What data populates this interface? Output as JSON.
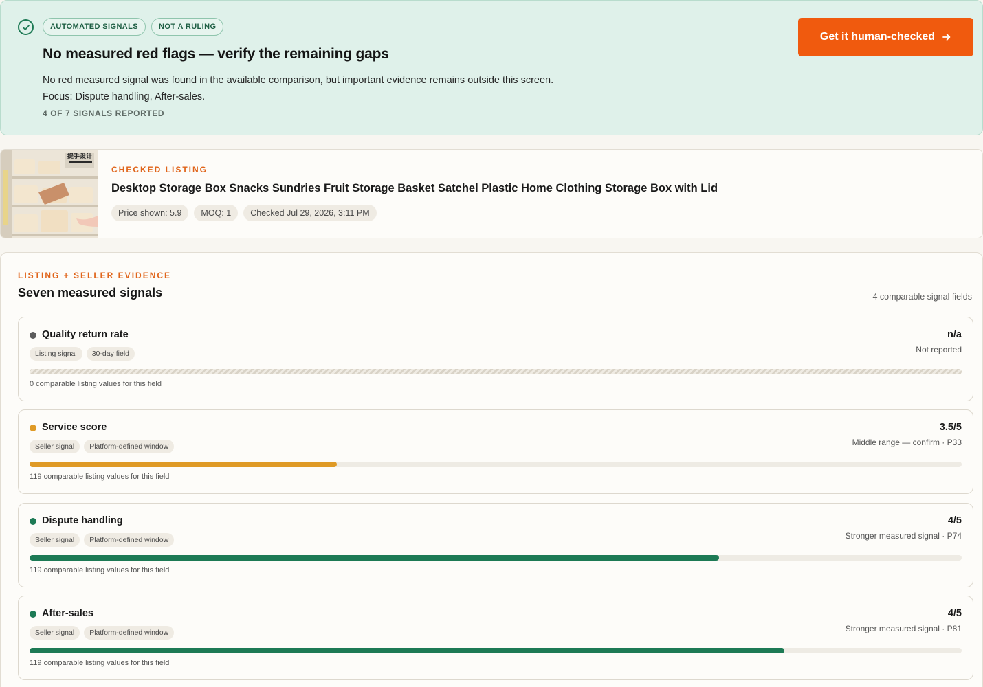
{
  "verdict": {
    "badges": [
      "AUTOMATED SIGNALS",
      "NOT A RULING"
    ],
    "title": "No measured red flags — verify the remaining gaps",
    "body_line1": "No red measured signal was found in the available comparison, but important evidence remains outside this screen.",
    "body_line2": "Focus: Dispute handling, After-sales.",
    "signals_reported": "4 OF 7 SIGNALS REPORTED",
    "cta_label": "Get it human-checked",
    "icons": {
      "status": "check-circle-icon",
      "cta": "arrow-right-icon"
    }
  },
  "listing": {
    "eyebrow": "CHECKED LISTING",
    "title": "Desktop Storage Box Snacks Sundries Fruit Storage Basket Satchel Plastic Home Clothing Storage Box with Lid",
    "thumb_brand_text": "提手设计",
    "chips": [
      "Price shown: 5.9",
      "MOQ: 1",
      "Checked Jul 29, 2026, 3:11 PM"
    ]
  },
  "evidence": {
    "eyebrow": "LISTING + SELLER EVIDENCE",
    "title": "Seven measured signals",
    "field_count": "4 comparable signal fields",
    "signals": [
      {
        "name": "Quality return rate",
        "tags": [
          "Listing signal",
          "30-day field"
        ],
        "value": "n/a",
        "note": "Not reported",
        "footer": "0 comparable listing values for this field",
        "fill": 0,
        "reported": false,
        "color": "#5c5c5c"
      },
      {
        "name": "Service score",
        "tags": [
          "Seller signal",
          "Platform-defined window"
        ],
        "value": "3.5/5",
        "note": "Middle range — confirm · P33",
        "footer": "119 comparable listing values for this field",
        "fill": 0.33,
        "reported": true,
        "color": "#df9a26"
      },
      {
        "name": "Dispute handling",
        "tags": [
          "Seller signal",
          "Platform-defined window"
        ],
        "value": "4/5",
        "note": "Stronger measured signal · P74",
        "footer": "119 comparable listing values for this field",
        "fill": 0.74,
        "reported": true,
        "color": "#1d7a55"
      },
      {
        "name": "After-sales",
        "tags": [
          "Seller signal",
          "Platform-defined window"
        ],
        "value": "4/5",
        "note": "Stronger measured signal · P81",
        "footer": "119 comparable listing values for this field",
        "fill": 0.81,
        "reported": true,
        "color": "#1d7a55"
      }
    ]
  }
}
